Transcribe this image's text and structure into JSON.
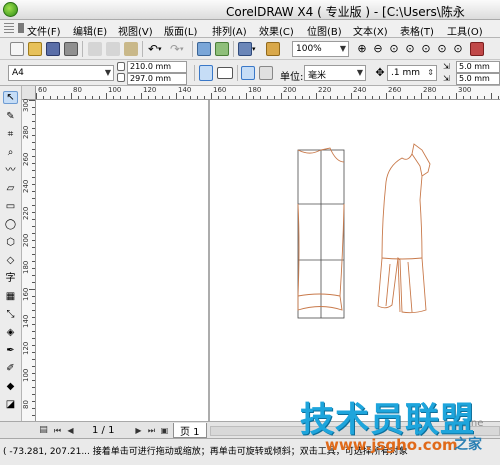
{
  "window": {
    "title": "CorelDRAW X4 ( 专业版 ) - [C:\\Users\\陈永"
  },
  "menu": [
    "文件(F)",
    "编辑(E)",
    "视图(V)",
    "版面(L)",
    "排列(A)",
    "效果(C)",
    "位图(B)",
    "文本(X)",
    "表格(T)",
    "工具(O)"
  ],
  "toolbar": {
    "zoom": "100%"
  },
  "property_bar": {
    "paper": "A4",
    "width": "210.0 mm",
    "height": "297.0 mm",
    "units_label": "单位:",
    "units": "毫米",
    "nudge": ".1 mm",
    "dup_x": "5.0 mm",
    "dup_y": "5.0 mm"
  },
  "rulers": {
    "h_labels": [
      "60",
      "80",
      "100",
      "120",
      "140",
      "160",
      "180",
      "200",
      "220",
      "240",
      "260",
      "280",
      "300"
    ],
    "v_labels": [
      "300",
      "280",
      "260",
      "240",
      "220",
      "200",
      "180",
      "160",
      "140",
      "120",
      "100",
      "80"
    ]
  },
  "toolbox": {
    "text_tool": "字"
  },
  "navigator": {
    "page_count": "1 / 1",
    "page_tab": "页 1"
  },
  "status": {
    "text": "( -73.281, 207.21... 接着单击可进行拖动或缩放；再单击可旋转或倾斜；双击工具，可选择所有对象"
  },
  "watermark": {
    "brand": "技术员联盟",
    "url": "www.jsgho.com",
    "site": "之家",
    "fragment": "51.ne"
  },
  "colors": {
    "pattern_line": "#c8794a",
    "frame_line": "#4a4a4a",
    "brand": "#1ea5dc"
  }
}
